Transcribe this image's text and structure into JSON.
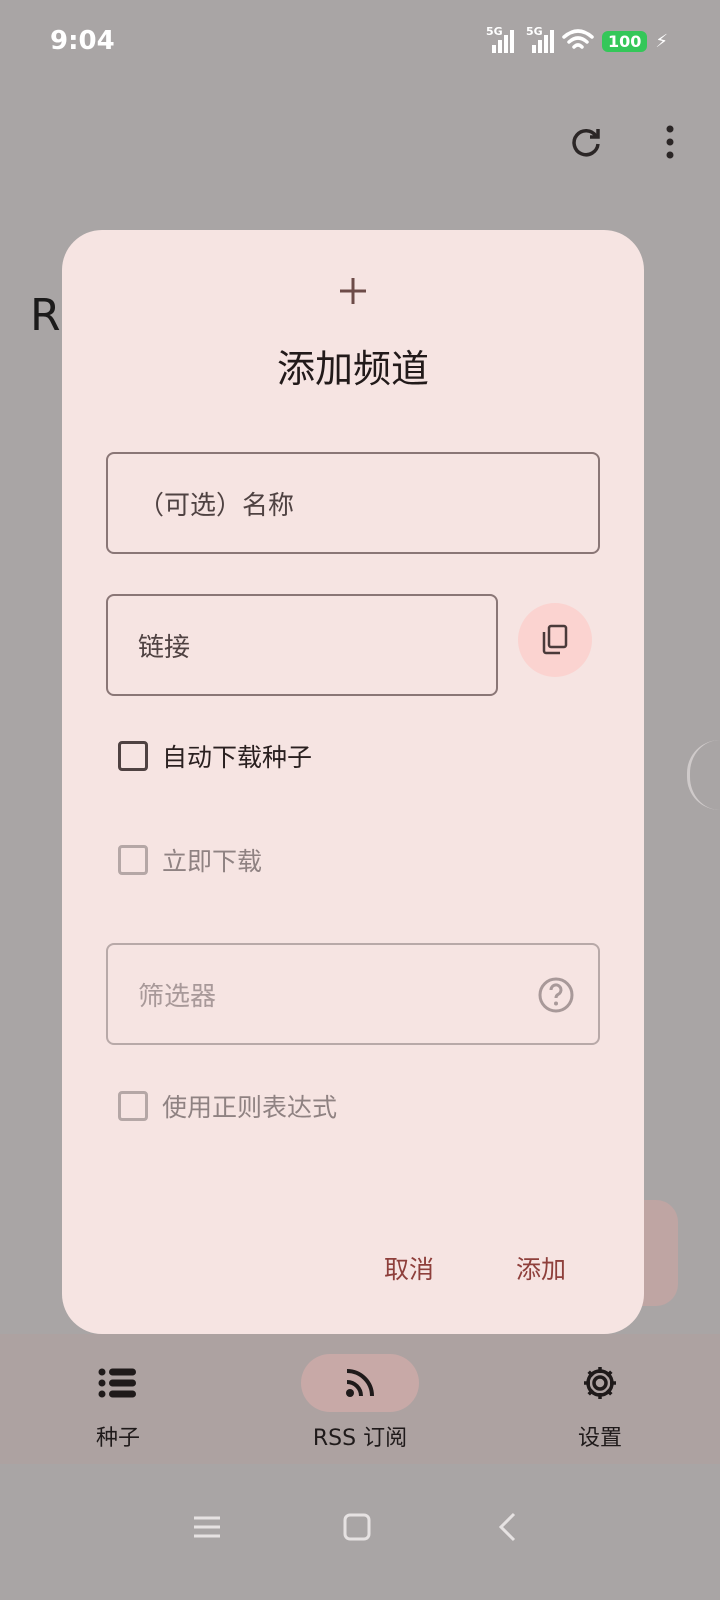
{
  "status_bar": {
    "time": "9:04",
    "signal_1_label": "5G",
    "signal_2_label": "5G",
    "battery": "100"
  },
  "background": {
    "title_fragment": "R"
  },
  "dialog": {
    "icon": "plus-icon",
    "title": "添加频道",
    "name_placeholder": "（可选）名称",
    "link_placeholder": "链接",
    "paste_icon": "content-paste-icon",
    "auto_download_label": "自动下载种子",
    "download_now_label": "立即下载",
    "filter_placeholder": "筛选器",
    "use_regex_label": "使用正则表达式",
    "cancel_label": "取消",
    "add_label": "添加"
  },
  "bottom_nav": {
    "items": [
      {
        "label": "种子",
        "icon": "list-icon",
        "active": false
      },
      {
        "label": "RSS 订阅",
        "icon": "rss-icon",
        "active": true
      },
      {
        "label": "设置",
        "icon": "gear-icon",
        "active": false
      }
    ]
  },
  "colors": {
    "scrim": "#a9a5a5",
    "dialog_bg": "#f6e4e2",
    "accent_text": "#8e3f3b",
    "active_pill": "#c8a9a7"
  }
}
